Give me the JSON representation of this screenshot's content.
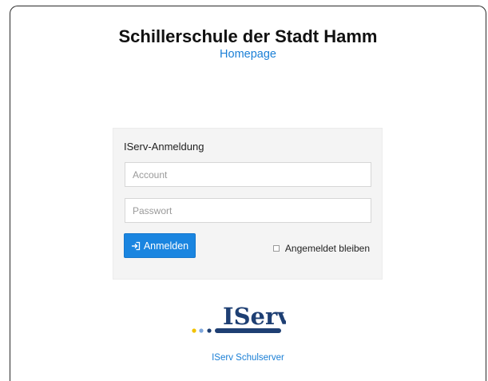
{
  "header": {
    "title": "Schillerschule der Stadt Hamm",
    "homepage_link": "Homepage"
  },
  "login": {
    "panel_title": "IServ-Anmeldung",
    "account_placeholder": "Account",
    "password_placeholder": "Passwort",
    "submit_label": "Anmelden",
    "remember_label": "Angemeldet bleiben"
  },
  "footer": {
    "logo_text": "IServ",
    "link": "IServ Schulserver"
  },
  "colors": {
    "brand_navy": "#1e3f73",
    "accent_blue": "#1a85e0",
    "link_blue": "#1a7fd6",
    "dot_yellow": "#f2c200",
    "dot_lightblue": "#7fa7dc"
  }
}
